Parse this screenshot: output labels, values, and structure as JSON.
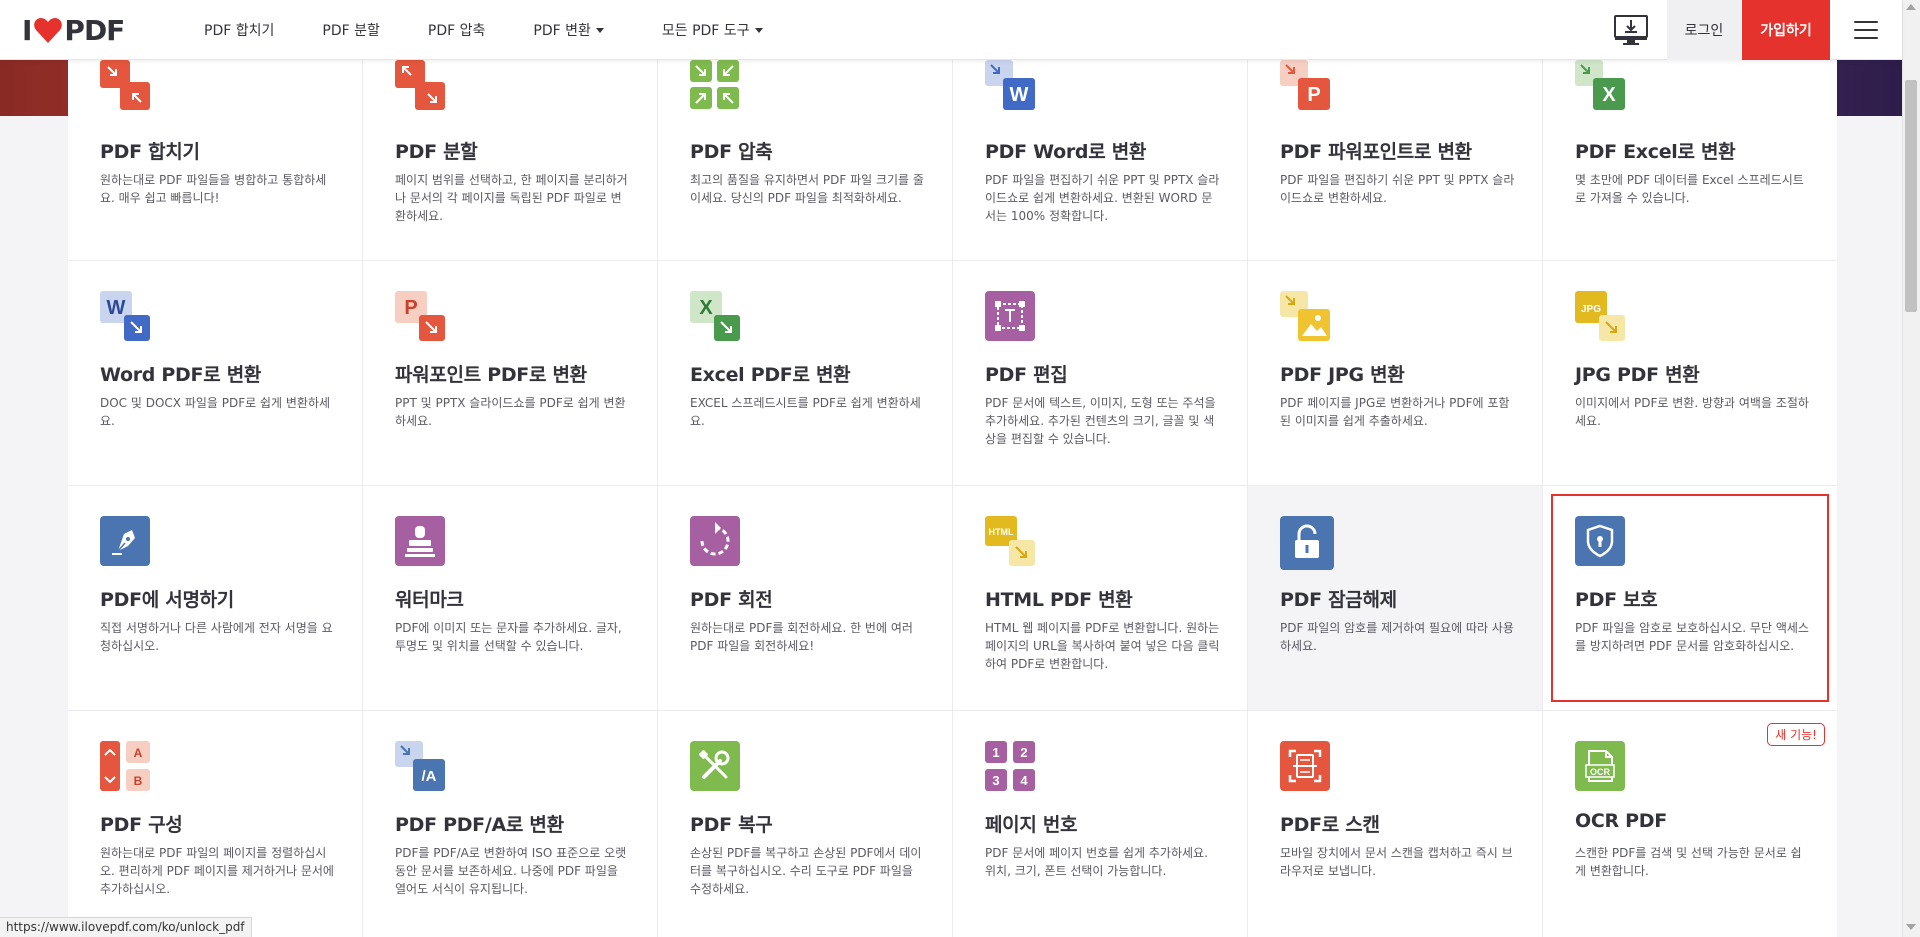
{
  "header": {
    "logo_i": "I",
    "logo_pdf": "PDF",
    "nav": [
      {
        "label": "PDF 합치기",
        "dropdown": false
      },
      {
        "label": "PDF 분할",
        "dropdown": false
      },
      {
        "label": "PDF 압축",
        "dropdown": false
      },
      {
        "label": "PDF 변환",
        "dropdown": true
      },
      {
        "label": "모든 PDF 도구",
        "dropdown": true
      }
    ],
    "login_label": "로그인",
    "signup_label": "가입하기"
  },
  "colors": {
    "brand_red": "#e5322d",
    "orange_red": "#e5563e",
    "green": "#7fba4f",
    "word_blue": "#4169c6",
    "excel_green": "#4a9a4d",
    "purple": "#a65fa0",
    "yellow": "#f0c430",
    "steel_blue": "#4a75b0"
  },
  "tools": [
    {
      "name": "merge",
      "icon": "merge-pdf-icon",
      "title": "PDF 합치기",
      "desc": "원하는대로 PDF 파일들을 병합하고 통합하세요. 매우 쉽고 빠릅니다!"
    },
    {
      "name": "split",
      "icon": "split-pdf-icon",
      "title": "PDF 분할",
      "desc": "페이지 범위를 선택하고, 한 페이지를 분리하거나 문서의 각 페이지를 독립된 PDF 파일로 변환하세요."
    },
    {
      "name": "compress",
      "icon": "compress-pdf-icon",
      "title": "PDF 압축",
      "desc": "최고의 품질을 유지하면서 PDF 파일 크기를 줄이세요. 당신의 PDF 파일을 최적화하세요."
    },
    {
      "name": "pdf-to-word",
      "icon": "pdf-to-word-icon",
      "title": "PDF Word로 변환",
      "desc": "PDF 파일을 편집하기 쉬운 PPT 및 PPTX 슬라이드쇼로 쉽게 변환하세요. 변환된 WORD 문서는 100% 정확합니다."
    },
    {
      "name": "pdf-to-ppt",
      "icon": "pdf-to-ppt-icon",
      "title": "PDF 파워포인트로 변환",
      "desc": "PDF 파일을 편집하기 쉬운 PPT 및 PPTX 슬라이드쇼로 변환하세요."
    },
    {
      "name": "pdf-to-excel",
      "icon": "pdf-to-excel-icon",
      "title": "PDF Excel로 변환",
      "desc": "몇 초만에 PDF 데이터를 Excel 스프레드시트로 가져올 수 있습니다."
    },
    {
      "name": "word-to-pdf",
      "icon": "word-to-pdf-icon",
      "title": "Word PDF로 변환",
      "desc": "DOC 및 DOCX 파일을 PDF로 쉽게 변환하세요."
    },
    {
      "name": "ppt-to-pdf",
      "icon": "ppt-to-pdf-icon",
      "title": "파워포인트 PDF로 변환",
      "desc": "PPT 및 PPTX 슬라이드쇼를 PDF로 쉽게 변환하세요."
    },
    {
      "name": "excel-to-pdf",
      "icon": "excel-to-pdf-icon",
      "title": "Excel PDF로 변환",
      "desc": "EXCEL 스프레드시트를 PDF로 쉽게 변환하세요."
    },
    {
      "name": "edit",
      "icon": "edit-pdf-icon",
      "title": "PDF 편집",
      "desc": "PDF 문서에 텍스트, 이미지, 도형 또는 주석을 추가하세요. 추가된 컨텐츠의 크기, 글꼴 및 색상을 편집할 수 있습니다."
    },
    {
      "name": "pdf-to-jpg",
      "icon": "pdf-to-jpg-icon",
      "title": "PDF JPG 변환",
      "desc": "PDF 페이지를 JPG로 변환하거나 PDF에 포함된 이미지를 쉽게 추출하세요."
    },
    {
      "name": "jpg-to-pdf",
      "icon": "jpg-to-pdf-icon",
      "title": "JPG PDF 변환",
      "desc": "이미지에서 PDF로 변환. 방향과 여백을 조절하세요."
    },
    {
      "name": "sign",
      "icon": "sign-pdf-icon",
      "title": "PDF에 서명하기",
      "desc": "직접 서명하거나 다른 사람에게 전자 서명을 요청하십시오."
    },
    {
      "name": "watermark",
      "icon": "watermark-icon",
      "title": "워터마크",
      "desc": "PDF에 이미지 또는 문자를 추가하세요. 글자, 투명도 및 위치를 선택할 수 있습니다."
    },
    {
      "name": "rotate",
      "icon": "rotate-pdf-icon",
      "title": "PDF 회전",
      "desc": "원하는대로 PDF를 회전하세요. 한 번에 여러 PDF 파일을 회전하세요!"
    },
    {
      "name": "html-to-pdf",
      "icon": "html-to-pdf-icon",
      "title": "HTML PDF 변환",
      "desc": "HTML 웹 페이지를 PDF로 변환합니다. 원하는 페이지의 URL을 복사하여 붙여 넣은 다음 클릭하여 PDF로 변환합니다."
    },
    {
      "name": "unlock",
      "icon": "unlock-pdf-icon",
      "title": "PDF 잠금해제",
      "desc": "PDF 파일의 암호를 제거하여 필요에 따라 사용하세요."
    },
    {
      "name": "protect",
      "icon": "protect-pdf-icon",
      "title": "PDF 보호",
      "desc": "PDF 파일을 암호로 보호하십시오. 무단 액세스를 방지하려면 PDF 문서를 암호화하십시오."
    },
    {
      "name": "organize",
      "icon": "organize-pdf-icon",
      "title": "PDF 구성",
      "desc": "원하는대로 PDF 파일의 페이지를 정렬하십시오. 편리하게 PDF 페이지를 제거하거나 문서에 추가하십시오."
    },
    {
      "name": "pdfa",
      "icon": "pdf-to-pdfa-icon",
      "title": "PDF PDF/A로 변환",
      "desc": "PDF를 PDF/A로 변환하여 ISO 표준으로 오랫동안 문서를 보존하세요. 나중에 PDF 파일을 열어도 서식이 유지됩니다."
    },
    {
      "name": "repair",
      "icon": "repair-pdf-icon",
      "title": "PDF 복구",
      "desc": "손상된 PDF를 복구하고 손상된 PDF에서 데이터를 복구하십시오. 수리 도구로 PDF 파일을 수정하세요."
    },
    {
      "name": "page-numbers",
      "icon": "page-numbers-icon",
      "title": "페이지 번호",
      "desc": "PDF 문서에 페이지 번호를 쉽게 추가하세요. 위치, 크기, 폰트 선택이 가능합니다."
    },
    {
      "name": "scan",
      "icon": "scan-to-pdf-icon",
      "title": "PDF로 스캔",
      "desc": "모바일 장치에서 문서 스캔을 캡처하고 즉시 브라우저로 보냅니다."
    },
    {
      "name": "ocr",
      "icon": "ocr-pdf-icon",
      "title": "OCR PDF",
      "desc": "스캔한 PDF를 검색 및 선택 가능한 문서로 쉽게 변환합니다.",
      "badge": "새 기능!"
    }
  ],
  "icon_text": {
    "word": "W",
    "ppt": "P",
    "excel": "X",
    "jpg": "JPG",
    "html": "HTML",
    "pdfa": "/A",
    "ocr": "OCR",
    "organize_a": "A",
    "organize_b": "B",
    "pages": [
      "1",
      "2",
      "3",
      "4"
    ]
  },
  "status_url": "https://www.ilovepdf.com/ko/unlock_pdf"
}
